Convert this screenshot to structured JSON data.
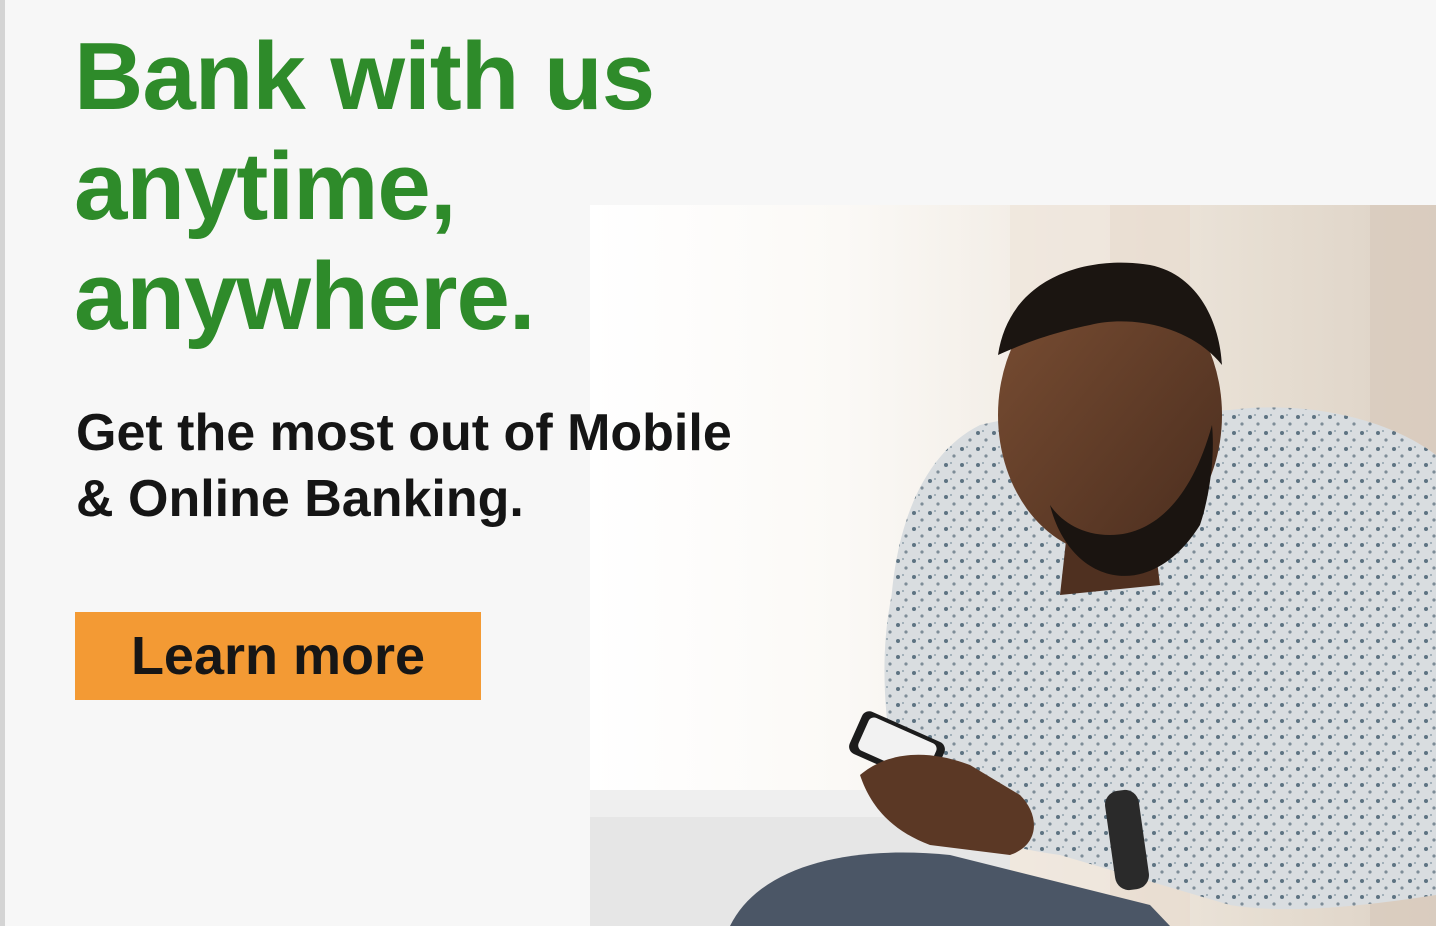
{
  "banner": {
    "headline_lines": [
      "Bank with us",
      "anytime,",
      "anywhere."
    ],
    "subhead_lines": [
      "Get the most out of Mobile",
      "& Online Banking."
    ],
    "cta_label": "Learn more"
  },
  "colors": {
    "headline": "#2e8b2a",
    "cta_background": "#f39a34",
    "subhead": "#151515",
    "page_background": "#f7f7f7"
  },
  "icons": {
    "hero_photo": "man-using-smartphone-photo"
  }
}
